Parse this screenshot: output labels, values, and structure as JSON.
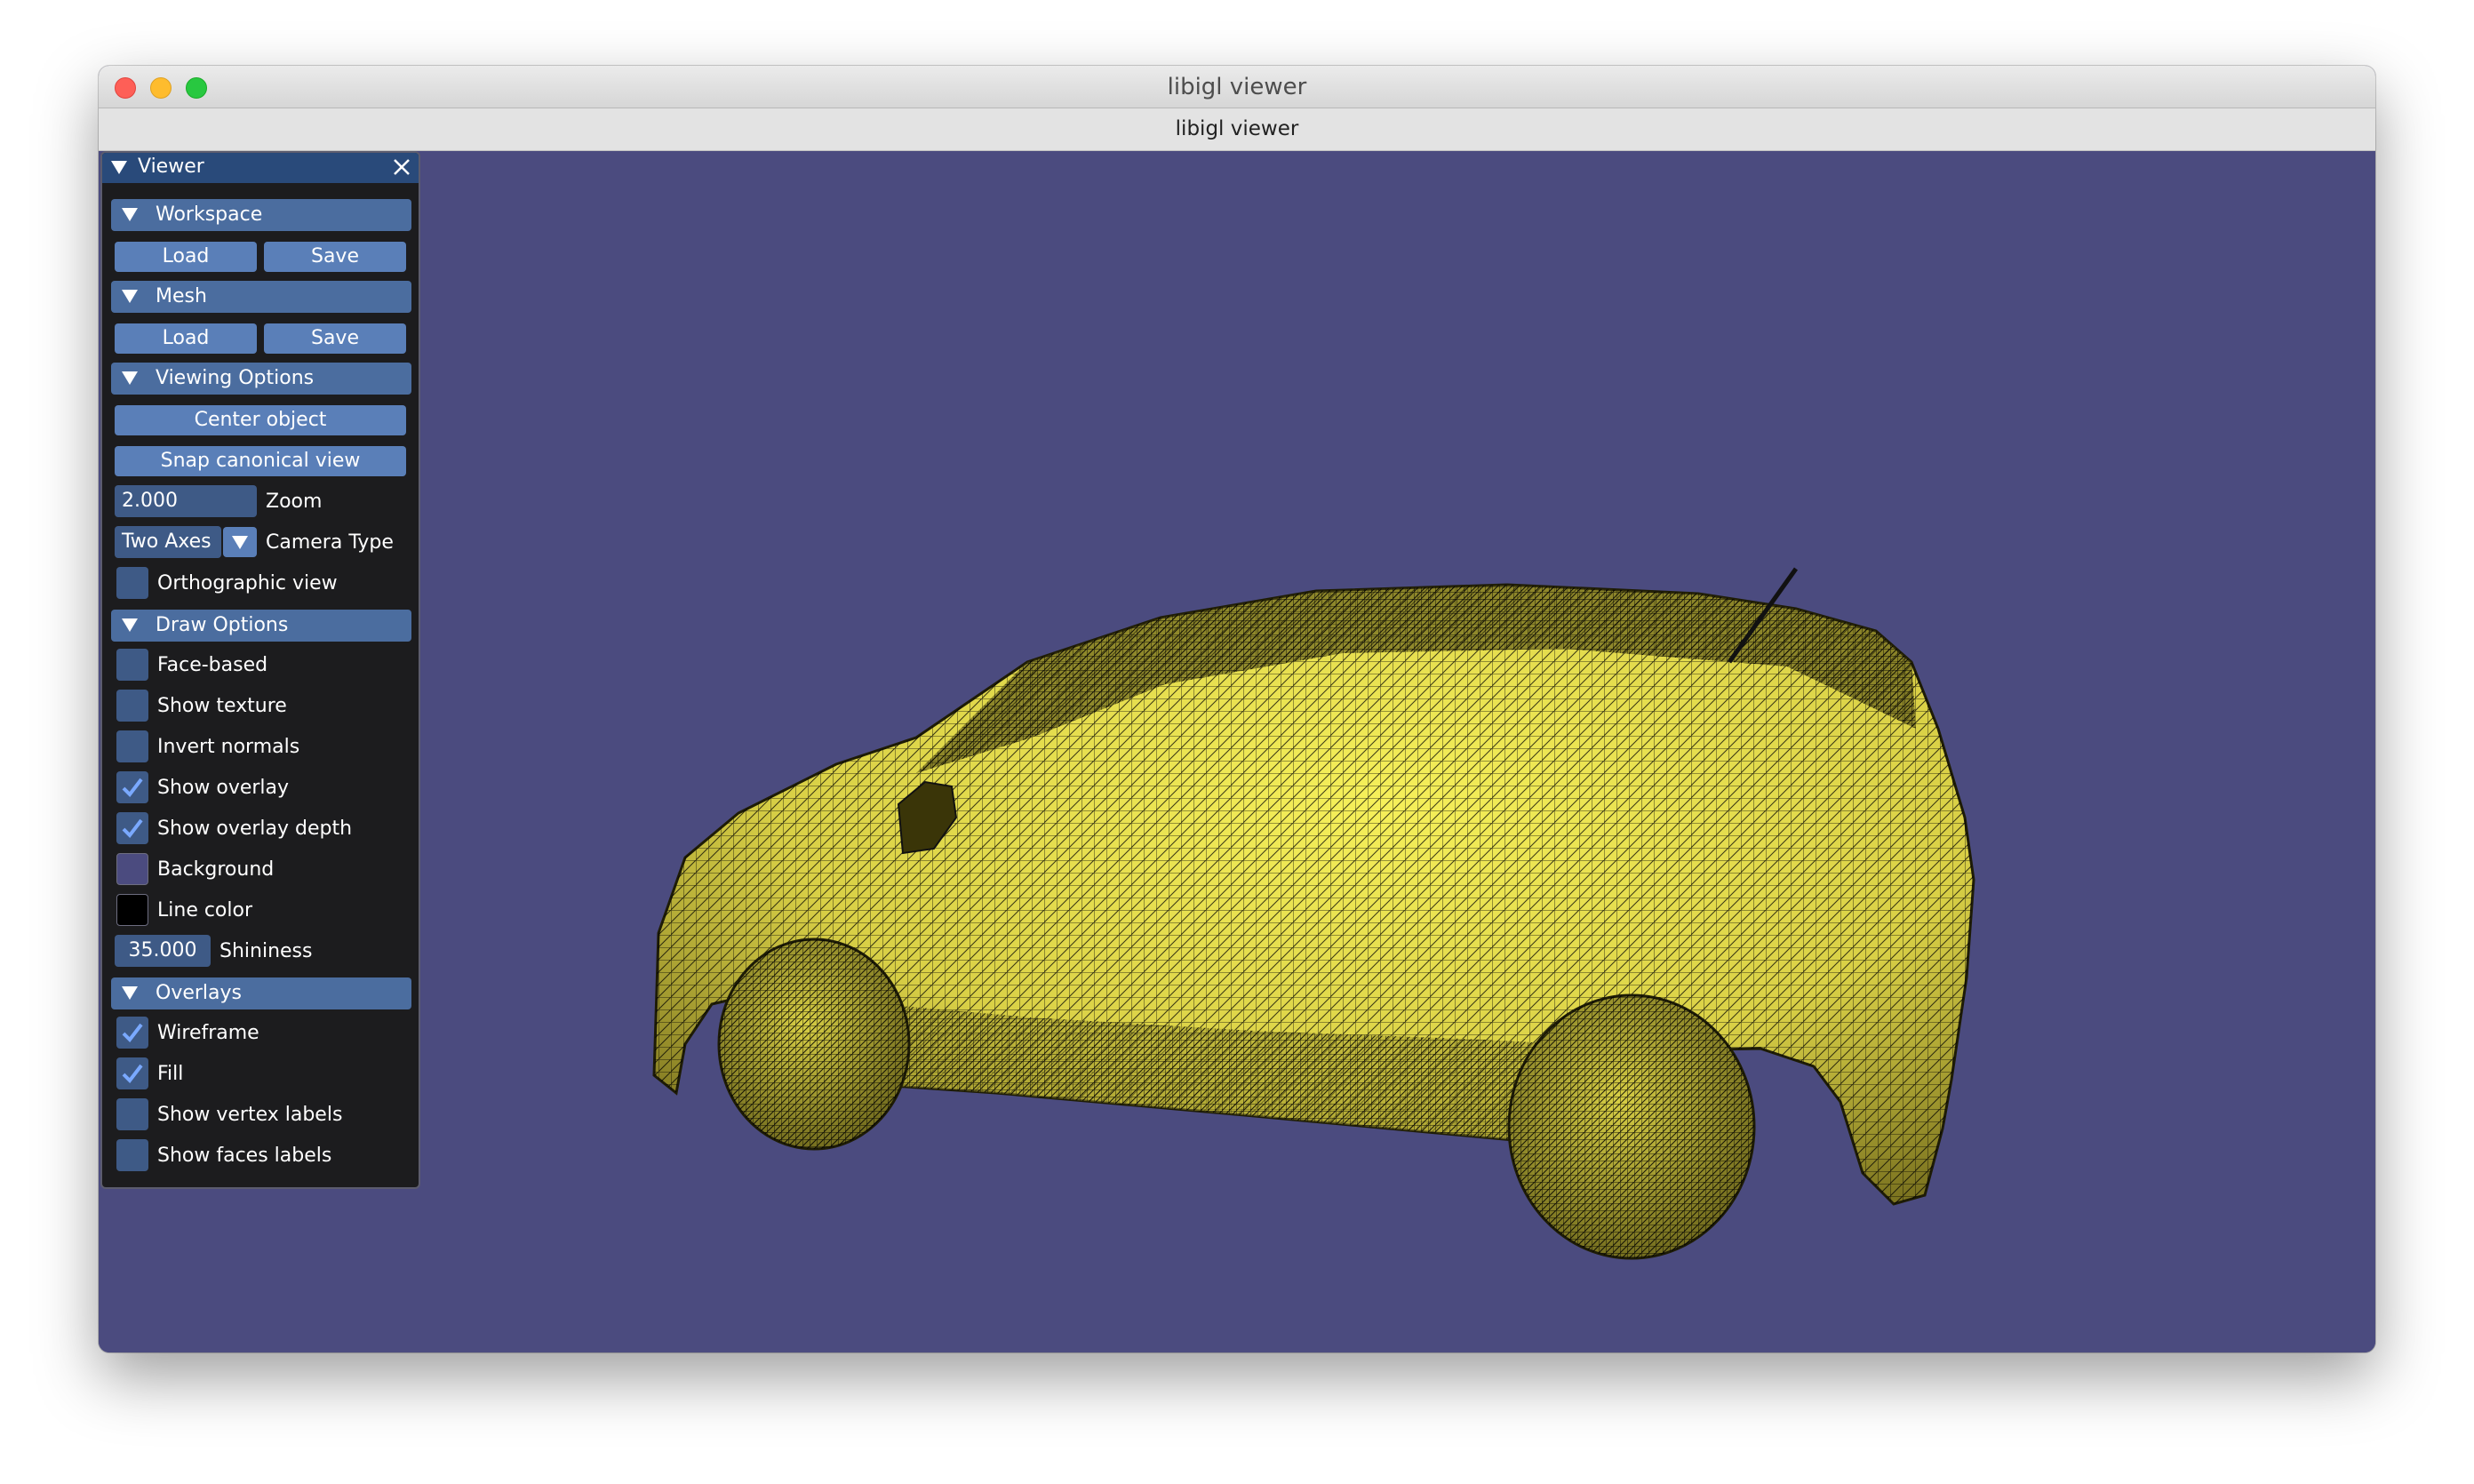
{
  "window": {
    "title": "libigl viewer",
    "tab_title": "libigl viewer"
  },
  "colors": {
    "background": "#4b4b7f",
    "mesh_fill": "#f0ea50",
    "line_color": "#000000",
    "panel_bg": "#1c1c1e",
    "header_bg": "#4b6d9f",
    "button_bg": "#5a7fb8",
    "check_color": "#7aa9ff"
  },
  "panel": {
    "title": "Viewer",
    "workspace": {
      "header": "Workspace",
      "load_label": "Load",
      "save_label": "Save"
    },
    "mesh": {
      "header": "Mesh",
      "load_label": "Load",
      "save_label": "Save"
    },
    "viewing": {
      "header": "Viewing Options",
      "center_label": "Center object",
      "snap_label": "Snap canonical view",
      "zoom_value": "2.000",
      "zoom_label": "Zoom",
      "camera_value": "Two Axes",
      "camera_label": "Camera Type",
      "ortho_label": "Orthographic view",
      "ortho_checked": false
    },
    "draw": {
      "header": "Draw Options",
      "items": [
        {
          "label": "Face-based",
          "checked": false
        },
        {
          "label": "Show texture",
          "checked": false
        },
        {
          "label": "Invert normals",
          "checked": false
        },
        {
          "label": "Show overlay",
          "checked": true
        },
        {
          "label": "Show overlay depth",
          "checked": true
        }
      ],
      "background_label": "Background",
      "line_color_label": "Line color",
      "shininess_value": "35.000",
      "shininess_label": "Shininess"
    },
    "overlays": {
      "header": "Overlays",
      "items": [
        {
          "label": "Wireframe",
          "checked": true
        },
        {
          "label": "Fill",
          "checked": true
        },
        {
          "label": "Show vertex labels",
          "checked": false
        },
        {
          "label": "Show faces labels",
          "checked": false
        }
      ]
    }
  }
}
